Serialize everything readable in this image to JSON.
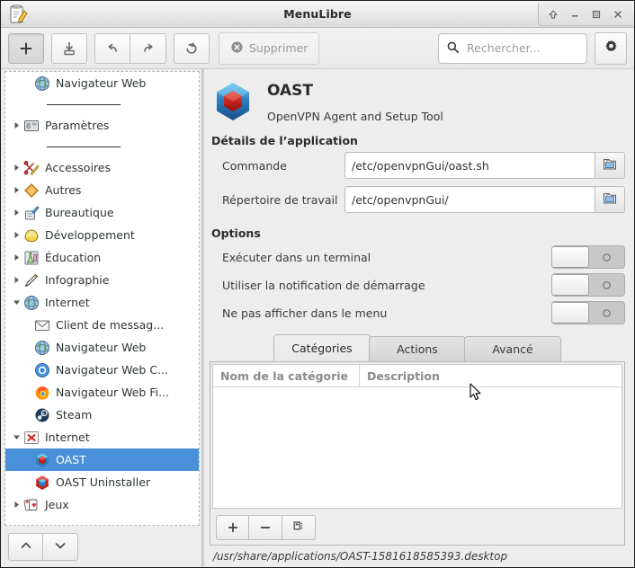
{
  "window": {
    "title": "MenuLibre",
    "title_icon": "menulibre-app-icon",
    "buttons": [
      {
        "name": "shade-button",
        "glyph": "⇧"
      },
      {
        "name": "minimize-button",
        "glyph": "–"
      },
      {
        "name": "maximize-button",
        "glyph": "□"
      },
      {
        "name": "close-button",
        "glyph": "✕"
      }
    ]
  },
  "toolbar": {
    "add_label": "+",
    "save_icon": "save-icon",
    "undo_icon": "undo-icon",
    "redo_icon": "redo-icon",
    "revert_icon": "revert-icon",
    "delete_label": "Supprimer",
    "delete_icon": "delete-circle-icon",
    "delete_disabled": true,
    "search_placeholder": "Rechercher...",
    "search_value": "",
    "search_icon": "search-icon",
    "settings_icon": "gear-icon"
  },
  "sidebar": {
    "items": [
      {
        "label": "Navigateur Web",
        "level": 2,
        "icon": "globe-icon",
        "expander": "none",
        "selected": false
      },
      {
        "label": "",
        "level": 0,
        "icon": "separator",
        "expander": "none",
        "selected": false,
        "separator": true
      },
      {
        "label": "Paramètres",
        "level": 1,
        "icon": "settings-panel-icon",
        "expander": "collapsed",
        "selected": false
      },
      {
        "label": "",
        "level": 0,
        "icon": "separator",
        "expander": "none",
        "selected": false,
        "separator": true
      },
      {
        "label": "Accessoires",
        "level": 1,
        "icon": "accessories-icon",
        "expander": "collapsed",
        "selected": false
      },
      {
        "label": "Autres",
        "level": 1,
        "icon": "other-icon",
        "expander": "collapsed",
        "selected": false
      },
      {
        "label": "Bureautique",
        "level": 1,
        "icon": "office-icon",
        "expander": "collapsed",
        "selected": false
      },
      {
        "label": "Développement",
        "level": 1,
        "icon": "development-icon",
        "expander": "collapsed",
        "selected": false
      },
      {
        "label": "Éducation",
        "level": 1,
        "icon": "education-icon",
        "expander": "collapsed",
        "selected": false
      },
      {
        "label": "Infographie",
        "level": 1,
        "icon": "graphics-icon",
        "expander": "collapsed",
        "selected": false
      },
      {
        "label": "Internet",
        "level": 1,
        "icon": "globe-icon",
        "expander": "expanded",
        "selected": false
      },
      {
        "label": "Client de messag...",
        "level": 2,
        "icon": "mail-icon",
        "expander": "none",
        "selected": false
      },
      {
        "label": "Navigateur Web",
        "level": 2,
        "icon": "globe-icon",
        "expander": "none",
        "selected": false
      },
      {
        "label": "Navigateur Web C...",
        "level": 2,
        "icon": "chromium-icon",
        "expander": "none",
        "selected": false
      },
      {
        "label": "Navigateur Web Fi...",
        "level": 2,
        "icon": "firefox-icon",
        "expander": "none",
        "selected": false
      },
      {
        "label": "Steam",
        "level": 2,
        "icon": "steam-icon",
        "expander": "none",
        "selected": false
      },
      {
        "label": "Internet",
        "level": 1,
        "icon": "broken-image-icon",
        "expander": "expanded",
        "selected": false
      },
      {
        "label": "OAST",
        "level": 2,
        "icon": "oast-icon",
        "expander": "none",
        "selected": true
      },
      {
        "label": "OAST Uninstaller",
        "level": 2,
        "icon": "oast-red-icon",
        "expander": "none",
        "selected": false
      },
      {
        "label": "Jeux",
        "level": 1,
        "icon": "games-icon",
        "expander": "collapsed",
        "selected": false
      }
    ],
    "move_up_icon": "chevron-up-icon",
    "move_down_icon": "chevron-down-icon"
  },
  "app": {
    "icon": "oast-icon",
    "name": "OAST",
    "description": "OpenVPN Agent and Setup Tool"
  },
  "details": {
    "section_title": "Détails de l’application",
    "fields": [
      {
        "label": "Commande",
        "value": "/etc/openvpnGui/oast.sh",
        "browse_icon": "folder-open-icon"
      },
      {
        "label": "Répertoire de travail",
        "value": "/etc/openvpnGui/",
        "browse_icon": "folder-open-icon"
      }
    ]
  },
  "options": {
    "section_title": "Options",
    "rows": [
      {
        "label": "Exécuter dans un terminal",
        "state": "off"
      },
      {
        "label": "Utiliser la notification de démarrage",
        "state": "off"
      },
      {
        "label": "Ne pas afficher dans le menu",
        "state": "off"
      }
    ]
  },
  "notebook": {
    "tabs": [
      {
        "label": "Catégories",
        "active": true
      },
      {
        "label": "Actions",
        "active": false
      },
      {
        "label": "Avancé",
        "active": false
      }
    ],
    "table": {
      "columns": [
        "Nom de la catégorie",
        "Description"
      ],
      "rows": []
    },
    "footer_buttons": [
      {
        "name": "add-category-button",
        "glyph": "+"
      },
      {
        "name": "remove-category-button",
        "glyph": "−"
      },
      {
        "name": "category-options-button",
        "glyph": "list-icon"
      }
    ]
  },
  "statusbar": {
    "path": "/usr/share/applications/OAST-1581618585393.desktop"
  },
  "colors": {
    "selection": "#4a90d9",
    "window_bg": "#ededed",
    "text": "#2e3436"
  }
}
